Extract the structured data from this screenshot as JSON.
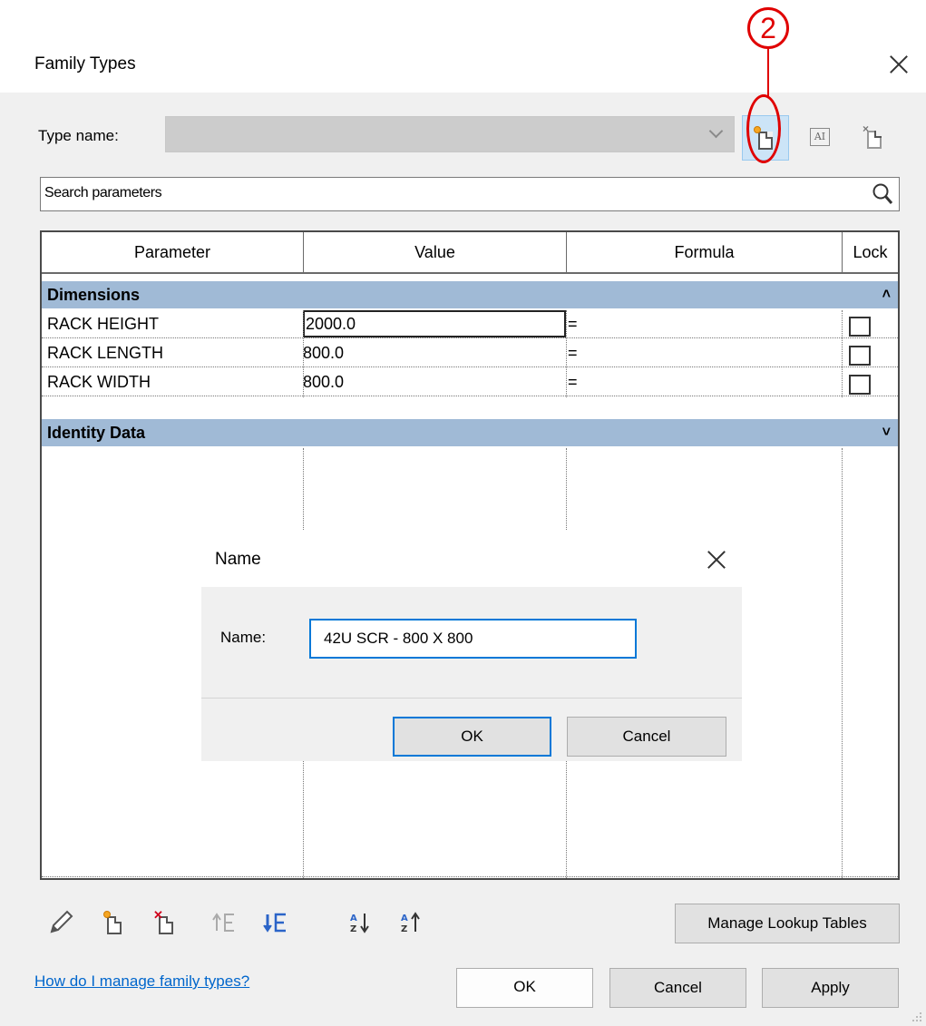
{
  "window": {
    "title": "Family Types"
  },
  "annotation": {
    "number": "2"
  },
  "type_name": {
    "label": "Type name:",
    "value": ""
  },
  "search": {
    "placeholder": "Search parameters"
  },
  "table": {
    "columns": [
      "Parameter",
      "Value",
      "Formula",
      "Lock"
    ],
    "groups": [
      {
        "name": "Dimensions",
        "expanded": true,
        "rows": [
          {
            "parameter": "RACK HEIGHT",
            "value": "2000.0",
            "formula": "=",
            "locked": false
          },
          {
            "parameter": "RACK LENGTH",
            "value": "800.0",
            "formula": "=",
            "locked": false
          },
          {
            "parameter": "RACK WIDTH",
            "value": "800.0",
            "formula": "=",
            "locked": false
          }
        ]
      },
      {
        "name": "Identity Data",
        "expanded": false,
        "rows": []
      }
    ]
  },
  "name_dialog": {
    "title": "Name",
    "label": "Name:",
    "value": "42U SCR - 800 X 800",
    "ok": "OK",
    "cancel": "Cancel"
  },
  "toolbar": {
    "icons": [
      "pencil-icon",
      "new-parameter-icon",
      "delete-parameter-icon",
      "move-up-icon",
      "move-down-icon",
      "sort-ascending-icon",
      "sort-descending-icon"
    ],
    "manage_lookup": "Manage Lookup Tables"
  },
  "footer": {
    "help_link": "How do I manage family types?",
    "ok": "OK",
    "cancel": "Cancel",
    "apply": "Apply"
  },
  "colors": {
    "accent": "#0078d7",
    "group_header": "#a0bad6",
    "annotation": "#e00000",
    "link": "#0066cc"
  }
}
